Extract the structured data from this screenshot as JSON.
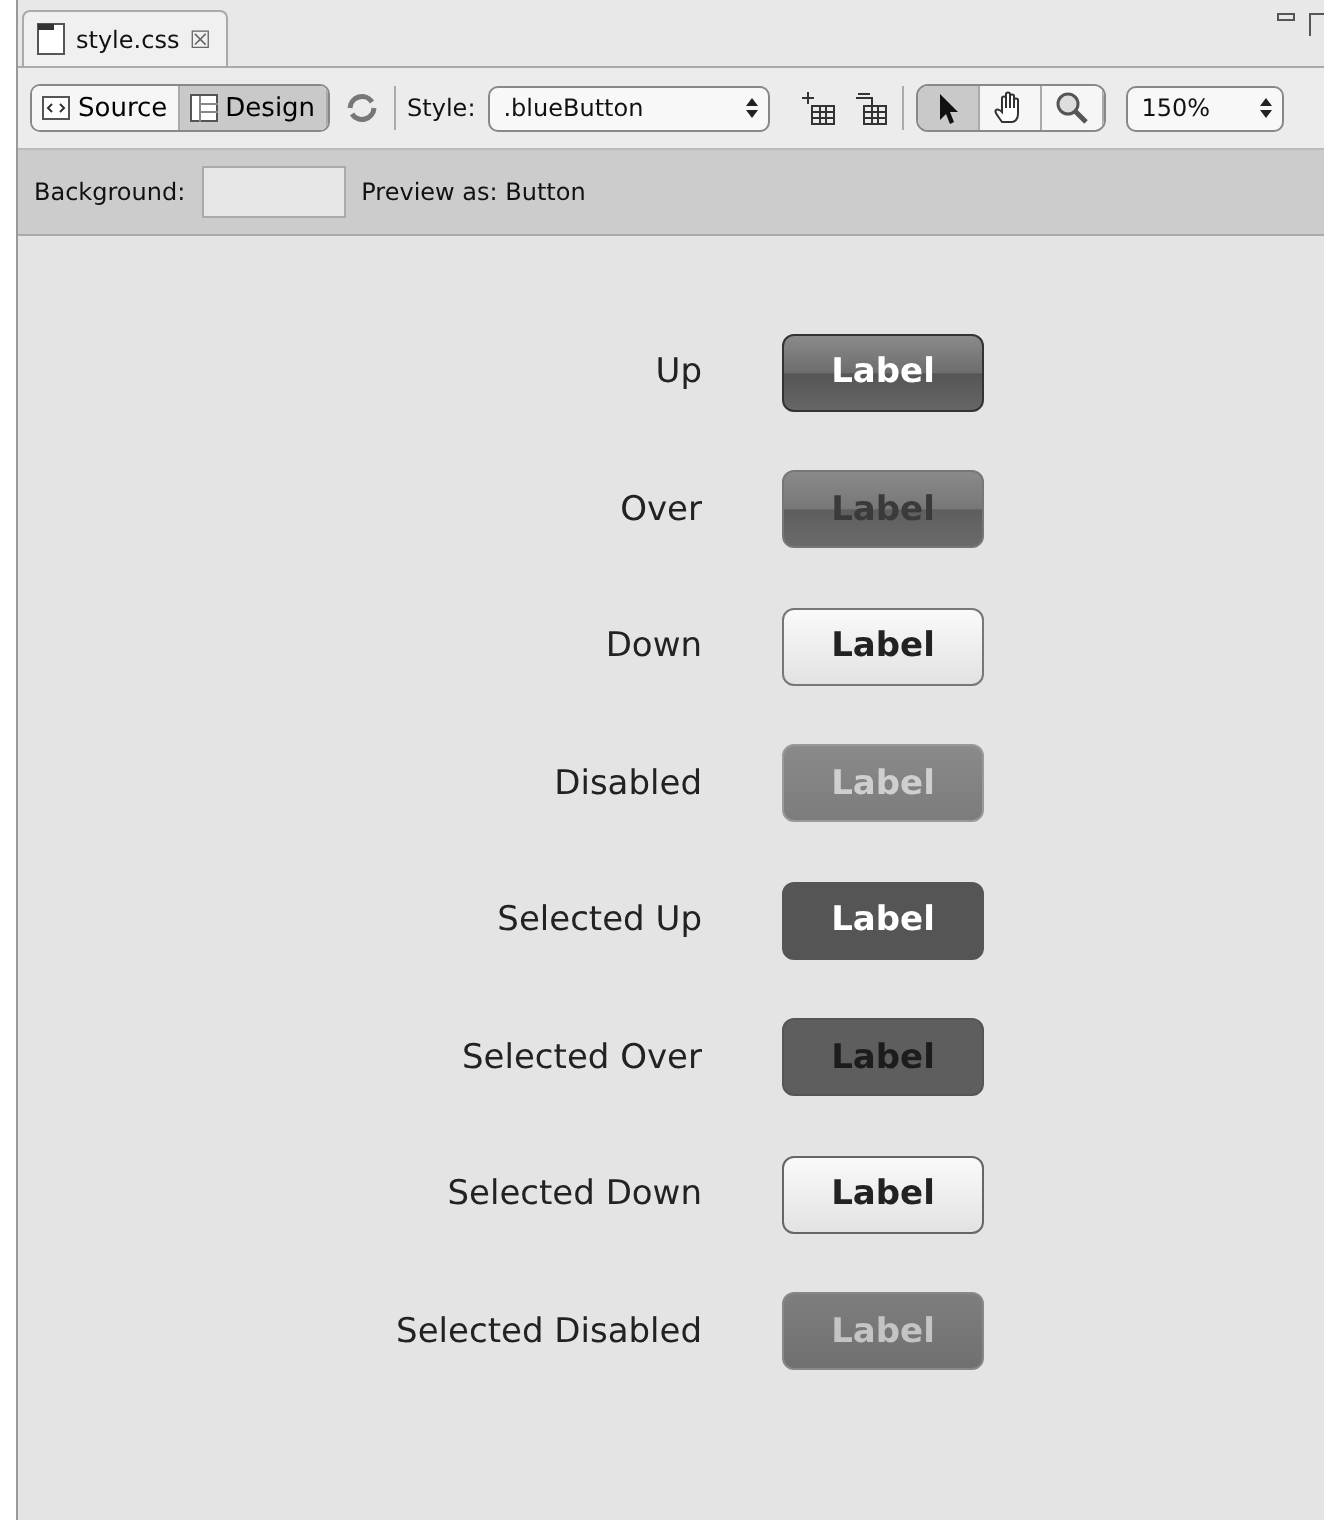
{
  "tab": {
    "title": "style.css",
    "close": "☒"
  },
  "toolbar": {
    "view_buttons": [
      {
        "label": "Source",
        "selected": false
      },
      {
        "label": "Design",
        "selected": true
      }
    ],
    "style_label": "Style:",
    "style_value": ".blueButton",
    "zoom_value": "150%",
    "tools": [
      {
        "kind": "arrow",
        "selected": true
      },
      {
        "kind": "hand",
        "selected": false
      },
      {
        "kind": "zoom",
        "selected": false
      }
    ]
  },
  "options": {
    "background_label": "Background:",
    "preview_label": "Preview as: Button"
  },
  "states": [
    {
      "name": "Up",
      "kind": "up",
      "button": "Label"
    },
    {
      "name": "Over",
      "kind": "over",
      "button": "Label"
    },
    {
      "name": "Down",
      "kind": "down",
      "button": "Label"
    },
    {
      "name": "Disabled",
      "kind": "disabled",
      "button": "Label"
    },
    {
      "name": "Selected Up",
      "kind": "selected-up",
      "button": "Label"
    },
    {
      "name": "Selected Over",
      "kind": "selected-over",
      "button": "Label"
    },
    {
      "name": "Selected Down",
      "kind": "selected-down",
      "button": "Label"
    },
    {
      "name": "Selected Disabled",
      "kind": "selected-disabled",
      "button": "Label"
    }
  ]
}
